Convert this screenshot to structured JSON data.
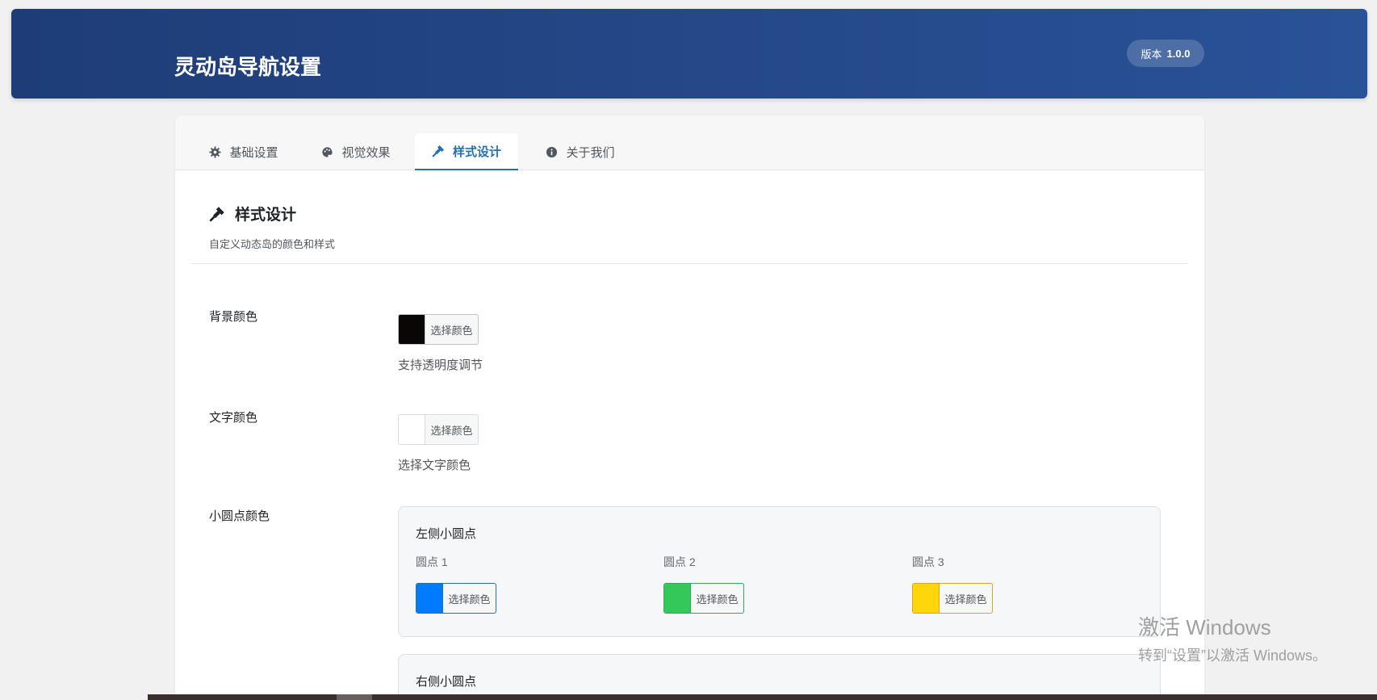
{
  "header": {
    "title": "灵动岛导航设置",
    "version_label": "版本",
    "version": "1.0.0"
  },
  "tabs": [
    {
      "label": "基础设置",
      "icon": "gear-icon"
    },
    {
      "label": "视觉效果",
      "icon": "palette-icon"
    },
    {
      "label": "样式设计",
      "icon": "brush-icon",
      "active": true
    },
    {
      "label": "关于我们",
      "icon": "info-icon"
    }
  ],
  "section": {
    "title": "样式设计",
    "description": "自定义动态岛的颜色和样式"
  },
  "fields": {
    "bg_color": {
      "label": "背景颜色",
      "button": "选择颜色",
      "color": "#0b0606",
      "help": "支持透明度调节"
    },
    "text_color": {
      "label": "文字颜色",
      "button": "选择颜色",
      "color": "#ffffff",
      "help": "选择文字颜色"
    },
    "dot_color": {
      "label": "小圆点颜色"
    }
  },
  "left_dots": {
    "title": "左侧小圆点",
    "dots": [
      {
        "label": "圆点 1",
        "button": "选择颜色",
        "color": "#007aff"
      },
      {
        "label": "圆点 2",
        "button": "选择颜色",
        "color": "#34c759"
      },
      {
        "label": "圆点 3",
        "button": "选择颜色",
        "color": "#ffd60a"
      }
    ]
  },
  "right_dots": {
    "title": "右侧小圆点"
  },
  "watermark": {
    "line1": "激活 Windows",
    "line2": "转到“设置”以激活 Windows。"
  }
}
